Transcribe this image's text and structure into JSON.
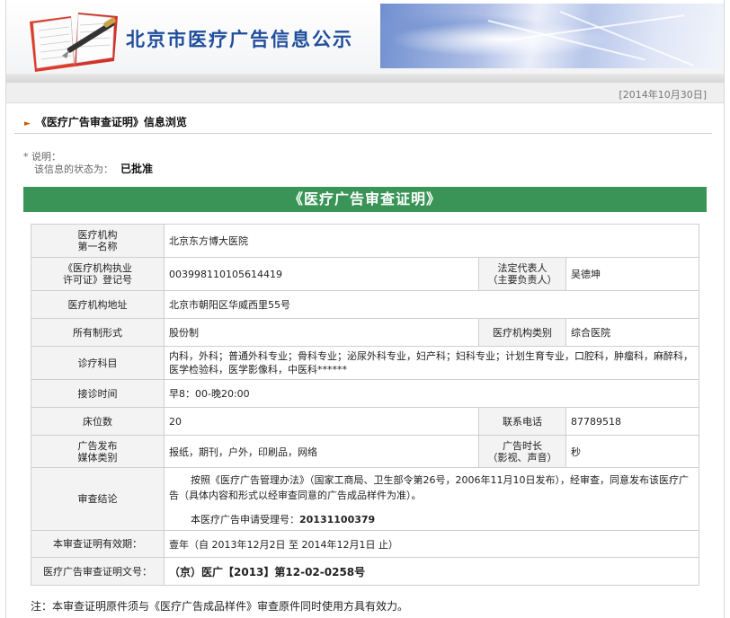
{
  "banner": {
    "title": "北京市医疗广告信息公示"
  },
  "date": "[2014年10月30日]",
  "heading": {
    "text": "《医疗广告审查证明》信息浏览"
  },
  "notes": {
    "label": "说明：",
    "status_label": "该信息的状态为：",
    "status_value": "已批准"
  },
  "certificate": {
    "title": "《医疗广告审查证明》",
    "rows": {
      "institution_name": {
        "label": [
          "医疗机构",
          "第一名称"
        ],
        "value": "北京东方博大医院"
      },
      "license": {
        "label": [
          "《医疗机构执业",
          "许可证》登记号"
        ],
        "value": "003998110105614419"
      },
      "legal_rep": {
        "label": [
          "法定代表人",
          "（主要负责人）"
        ],
        "value": "吴德坤"
      },
      "address": {
        "label": "医疗机构地址",
        "value": "北京市朝阳区华威西里55号"
      },
      "ownership": {
        "label": "所有制形式",
        "value": "股份制"
      },
      "category": {
        "label": "医疗机构类别",
        "value": "综合医院"
      },
      "departments": {
        "label": "诊疗科目",
        "value": "内科，外科；普通外科专业；骨科专业；泌尿外科专业，妇产科；妇科专业；计划生育专业，口腔科，肿瘤科，麻醉科，医学检验科，医学影像科，中医科******"
      },
      "hours": {
        "label": "接诊时间",
        "value": "早8：00-晚20:00"
      },
      "beds": {
        "label": "床位数",
        "value": "20"
      },
      "phone": {
        "label": "联系电话",
        "value": "87789518"
      },
      "media": {
        "label": [
          "广告发布",
          "媒体类别"
        ],
        "value": "报纸，期刊，户外，印刷品，网络"
      },
      "duration": {
        "label": [
          "广告时长",
          "（影视、声音）"
        ],
        "value": "秒"
      },
      "conclusion": {
        "label": "审查结论",
        "text": "按照《医疗广告管理办法》（国家工商局、卫生部令第26号，2006年11月10日发布），经审查，同意发布该医疗广告（具体内容和形式以经审查同意的广告成品样件为准）。",
        "app_no_label": "本医疗广告申请受理号：",
        "app_no": "20131100379"
      },
      "validity": {
        "label": "本审查证明有效期：",
        "value": "壹年（自 2013年12月2日 至 2014年12月1日 止）"
      },
      "doc_no": {
        "label": "医疗广告审查证明文号：",
        "value": "（京）医广【2013】第12-02-0258号"
      }
    }
  },
  "footnote": "注：本审查证明原件须与《医疗广告成品样件》审查原件同时使用方具有效力。"
}
